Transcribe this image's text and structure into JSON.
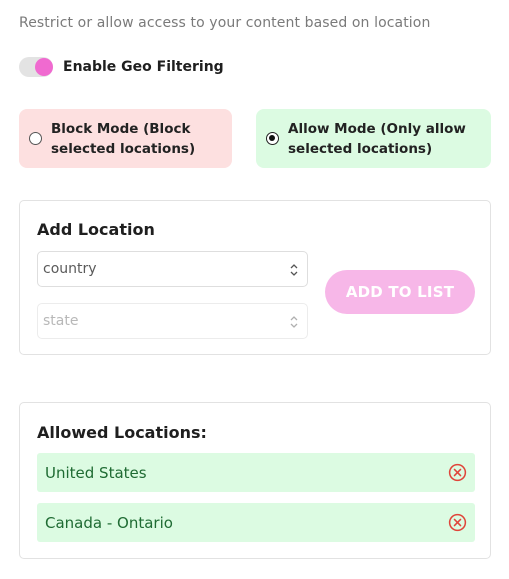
{
  "intro_text": "Restrict or allow access to your content based on location",
  "geo_toggle": {
    "label": "Enable Geo Filtering",
    "enabled": true
  },
  "modes": {
    "block_label": "Block Mode (Block selected locations)",
    "allow_label": "Allow Mode (Only allow selected locations)",
    "selected": "allow"
  },
  "add_location": {
    "title": "Add Location",
    "country_select": "country",
    "state_select": "state",
    "add_button": "ADD TO LIST"
  },
  "allowed_locations": {
    "title": "Allowed Locations:",
    "items": [
      {
        "label": "United States"
      },
      {
        "label": "Canada - Ontario"
      }
    ]
  },
  "colors": {
    "accent_pink": "#f06ad0",
    "button_pink": "#f7b7e8",
    "block_bg": "#fde0e0",
    "allow_bg": "#dcfbe2",
    "remove_red": "#e0443a"
  }
}
